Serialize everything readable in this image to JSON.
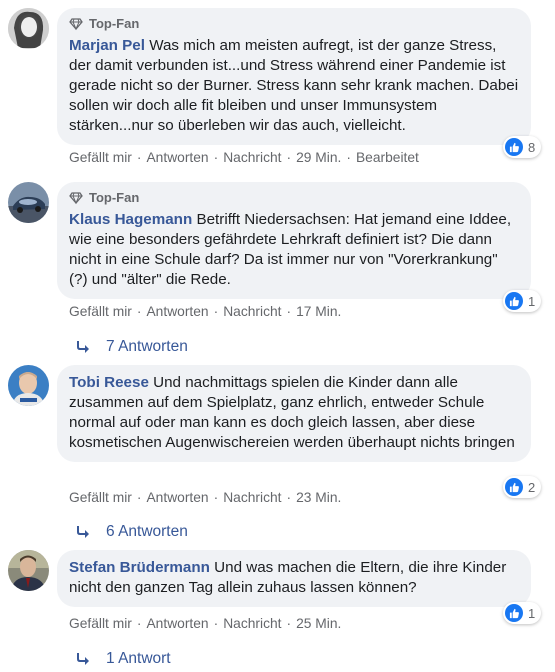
{
  "labels": {
    "like": "Gefällt mir",
    "reply": "Antworten",
    "message": "Nachricht",
    "separator": "·"
  },
  "colors": {
    "accent": "#385898",
    "like_blue": "#1877f2",
    "bubble": "#f0f2f5",
    "meta": "#65676b"
  },
  "comments": [
    {
      "badge": "Top-Fan",
      "author": "Marjan Pel",
      "text": "Was mich am meisten aufregt, ist der ganze Stress, der damit verbunden ist...und Stress während einer Pandemie ist gerade nicht so der Burner. Stress kann sehr krank machen. Dabei sollen wir doch alle fit bleiben und unser Immunsystem stärken...nur so überleben wir das auch, vielleicht.",
      "reactions": "8",
      "time": "29 Min.",
      "edited": "Bearbeitet",
      "replies": ""
    },
    {
      "badge": "Top-Fan",
      "author": "Klaus Hagemann",
      "text": "Betrifft Niedersachsen: Hat jemand eine Iddee, wie eine besonders gefährdete Lehrkraft definiert ist? Die dann nicht in eine Schule darf? Da ist immer nur von \"Vorerkrankung\" (?) und \"älter\" die Rede.",
      "reactions": "1",
      "time": "17 Min.",
      "edited": "",
      "replies": "7 Antworten"
    },
    {
      "badge": "",
      "author": "Tobi Reese",
      "text": "Und nachmittags spielen die Kinder dann alle zusammen auf dem Spielplatz, ganz ehrlich, entweder Schule normal auf oder man kann es doch gleich lassen, aber diese kosmetischen Augenwischereien werden überhaupt nichts bringen",
      "reactions": "2",
      "time": "23 Min.",
      "edited": "",
      "replies": "6 Antworten"
    },
    {
      "badge": "",
      "author": "Stefan Brüdermann",
      "text": "Und was machen die Eltern, die ihre Kinder nicht den ganzen Tag allein zuhaus lassen können?",
      "reactions": "1",
      "time": "25 Min.",
      "edited": "",
      "replies": "1 Antwort"
    }
  ]
}
